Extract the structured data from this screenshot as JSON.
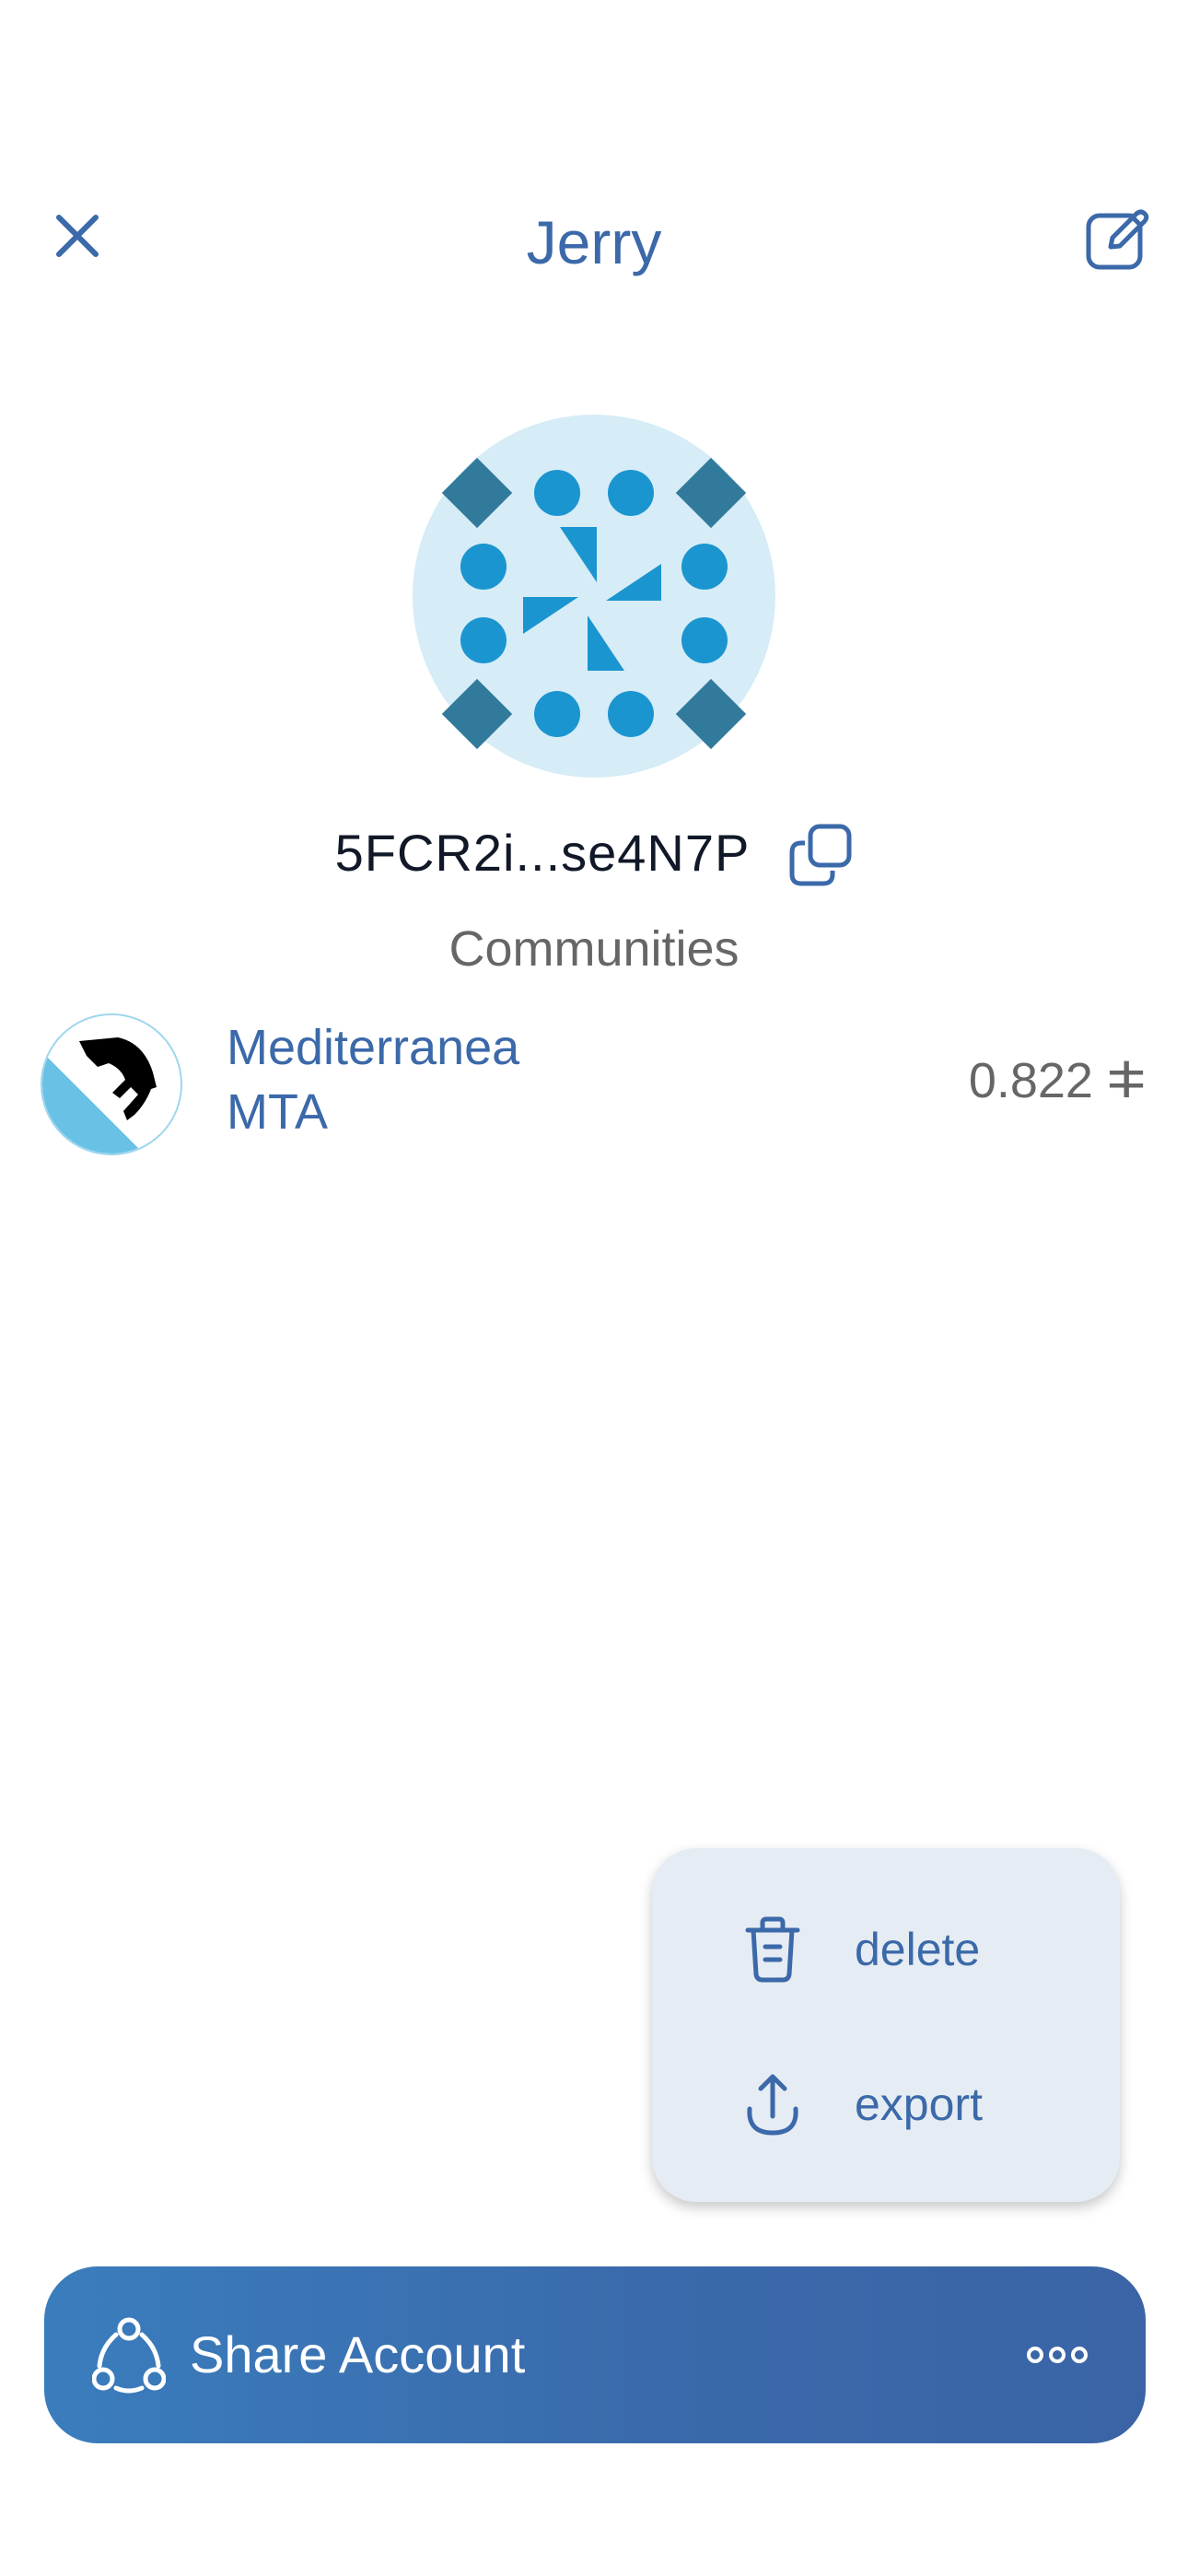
{
  "header": {
    "title": "Jerry",
    "close_icon": "close-icon",
    "edit_icon": "edit-icon"
  },
  "account": {
    "address": "5FCR2i...se4N7P",
    "copy_icon": "copy-icon",
    "identicon_colors": {
      "background": "#d6ecf7",
      "primary": "#1b95d0",
      "secondary": "#327a9b"
    }
  },
  "communities": {
    "title": "Communities",
    "items": [
      {
        "name": "Mediterranea",
        "symbol": "MTA",
        "balance": "0.822 ⵐ"
      }
    ]
  },
  "menu": {
    "items": [
      {
        "label": "delete",
        "icon": "trash-icon"
      },
      {
        "label": "export",
        "icon": "upload-icon"
      }
    ]
  },
  "share_bar": {
    "label": "Share Account",
    "share_icon": "share-icon",
    "more_icon": "more-horizontal-icon"
  },
  "colors": {
    "accent": "#3b69a9",
    "text_dark": "#111827",
    "text_muted": "#666666",
    "menu_bg": "#e5ecf3"
  }
}
